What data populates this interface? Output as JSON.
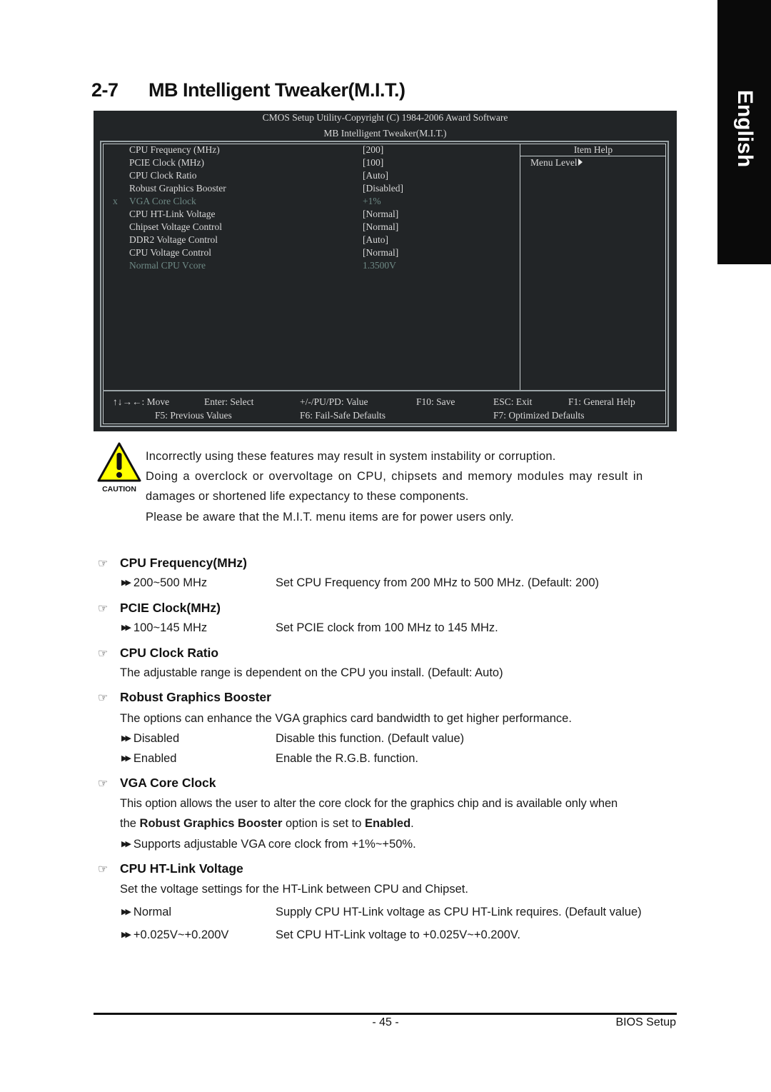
{
  "side_tab": {
    "label": "English"
  },
  "heading": {
    "number": "2-7",
    "title": "MB Intelligent Tweaker(M.I.T.)"
  },
  "bios": {
    "copyright": "CMOS Setup Utility-Copyright (C) 1984-2006 Award Software",
    "screen_title": "MB Intelligent Tweaker(M.I.T.)",
    "items": [
      {
        "mark": "",
        "label": "CPU Frequency (MHz)",
        "value": "[200]",
        "disabled": false
      },
      {
        "mark": "",
        "label": "PCIE Clock (MHz)",
        "value": "[100]",
        "disabled": false
      },
      {
        "mark": "",
        "label": "CPU Clock Ratio",
        "value": "[Auto]",
        "disabled": false
      },
      {
        "mark": "",
        "label": "Robust Graphics Booster",
        "value": "[Disabled]",
        "disabled": false
      },
      {
        "mark": "x",
        "label": "VGA Core Clock",
        "value": "+1%",
        "disabled": true
      },
      {
        "mark": "",
        "label": "CPU HT-Link Voltage",
        "value": "[Normal]",
        "disabled": false
      },
      {
        "mark": "",
        "label": "Chipset Voltage Control",
        "value": "[Normal]",
        "disabled": false
      },
      {
        "mark": "",
        "label": "DDR2 Voltage Control",
        "value": "[Auto]",
        "disabled": false
      },
      {
        "mark": "",
        "label": "CPU Voltage Control",
        "value": "[Normal]",
        "disabled": false
      },
      {
        "mark": "",
        "label": "Normal CPU Vcore",
        "value": "1.3500V",
        "disabled": true
      }
    ],
    "help": {
      "title": "Item Help",
      "menu_level": "Menu Level"
    },
    "keys_row1": [
      "↑↓→←: Move",
      "Enter: Select",
      "+/-/PU/PD: Value",
      "F10: Save",
      "ESC: Exit",
      "F1: General Help"
    ],
    "keys_row2": [
      "F5: Previous Values",
      "F6: Fail-Safe Defaults",
      "F7: Optimized Defaults"
    ]
  },
  "caution": {
    "icon_label": "CAUTION",
    "lines": [
      "Incorrectly using these features may result in system instability or corruption.",
      "Doing a overclock or overvoltage on CPU, chipsets and memory modules may result in",
      "damages or shortened life expectancy to these components.",
      "Please be aware that the M.I.T. menu items are for power users only."
    ]
  },
  "sections": {
    "cpu_freq": {
      "title": "CPU Frequency(MHz)",
      "options": [
        {
          "name": "200~500 MHz",
          "desc": "Set CPU Frequency from 200 MHz to 500 MHz. (Default: 200)"
        }
      ]
    },
    "pcie": {
      "title": "PCIE Clock(MHz)",
      "options": [
        {
          "name": "100~145 MHz",
          "desc": "Set PCIE clock from 100 MHz to 145 MHz."
        }
      ]
    },
    "ratio": {
      "title": "CPU Clock Ratio",
      "text": "The adjustable range is dependent on the CPU you install. (Default: Auto)"
    },
    "rgb": {
      "title": "Robust Graphics Booster",
      "text": "The options can enhance the VGA graphics card bandwidth to get higher performance.",
      "options": [
        {
          "name": "Disabled",
          "desc": "Disable this function. (Default value)"
        },
        {
          "name": "Enabled",
          "desc": "Enable the R.G.B. function."
        }
      ]
    },
    "vga": {
      "title": "VGA Core Clock",
      "text1": "This option allows the user to alter the core clock for the graphics chip and is available only when",
      "text2_pre": "the ",
      "text2_bold1": "Robust Graphics Booster",
      "text2_mid": " option is set to ",
      "text2_bold2": "Enabled",
      "text2_post": ".",
      "bullet": "Supports adjustable VGA core clock from +1%~+50%."
    },
    "htlink": {
      "title": "CPU HT-Link Voltage",
      "text": "Set the voltage settings for the HT-Link between CPU and Chipset.",
      "options": [
        {
          "name": "Normal",
          "desc": "Supply CPU HT-Link voltage as CPU HT-Link requires. (Default value)"
        },
        {
          "name": "+0.025V~+0.200V",
          "desc": "Set CPU HT-Link voltage to +0.025V~+0.200V."
        }
      ]
    }
  },
  "footer": {
    "page": "- 45 -",
    "section": "BIOS Setup"
  }
}
